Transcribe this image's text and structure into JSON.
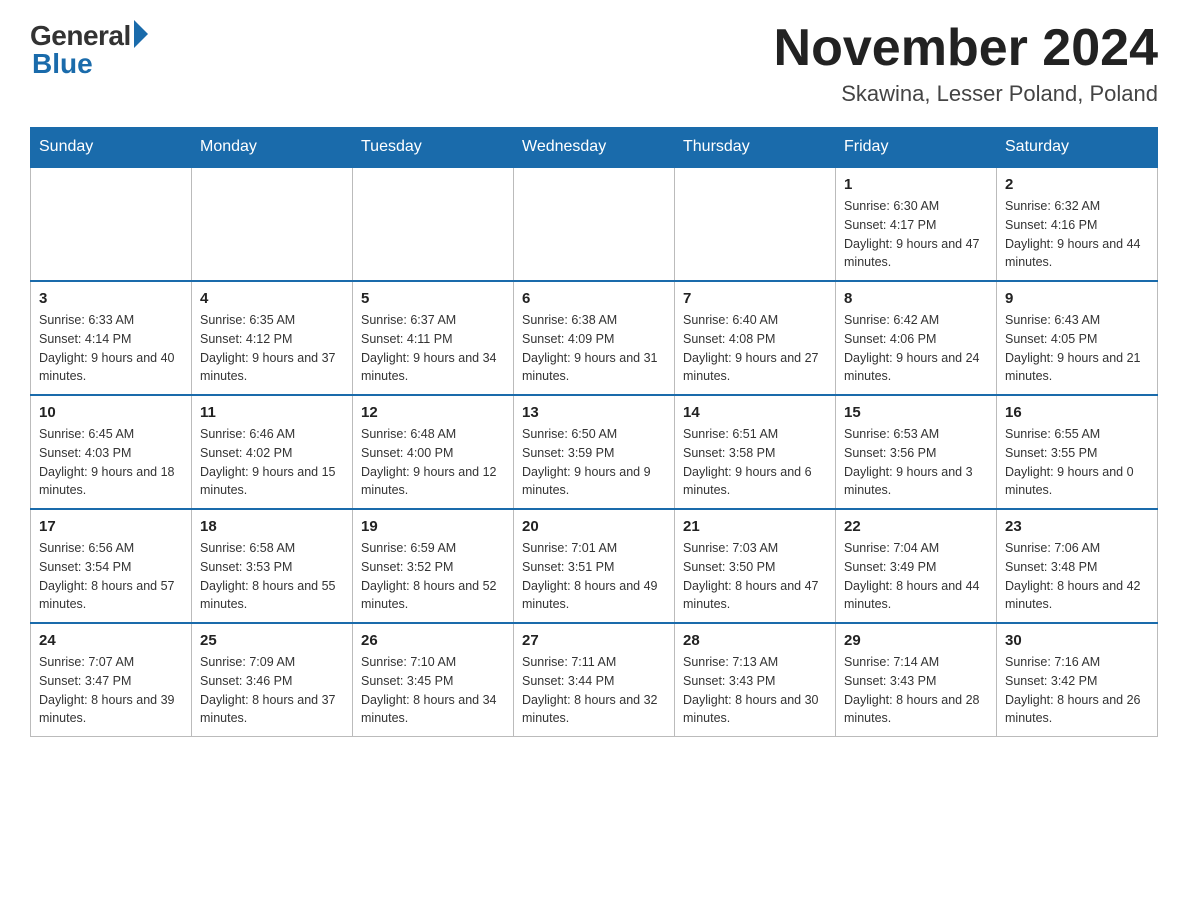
{
  "header": {
    "logo_general": "General",
    "logo_blue": "Blue",
    "month_title": "November 2024",
    "location": "Skawina, Lesser Poland, Poland"
  },
  "days_of_week": [
    "Sunday",
    "Monday",
    "Tuesday",
    "Wednesday",
    "Thursday",
    "Friday",
    "Saturday"
  ],
  "weeks": [
    [
      {
        "day": "",
        "info": ""
      },
      {
        "day": "",
        "info": ""
      },
      {
        "day": "",
        "info": ""
      },
      {
        "day": "",
        "info": ""
      },
      {
        "day": "",
        "info": ""
      },
      {
        "day": "1",
        "info": "Sunrise: 6:30 AM\nSunset: 4:17 PM\nDaylight: 9 hours and 47 minutes."
      },
      {
        "day": "2",
        "info": "Sunrise: 6:32 AM\nSunset: 4:16 PM\nDaylight: 9 hours and 44 minutes."
      }
    ],
    [
      {
        "day": "3",
        "info": "Sunrise: 6:33 AM\nSunset: 4:14 PM\nDaylight: 9 hours and 40 minutes."
      },
      {
        "day": "4",
        "info": "Sunrise: 6:35 AM\nSunset: 4:12 PM\nDaylight: 9 hours and 37 minutes."
      },
      {
        "day": "5",
        "info": "Sunrise: 6:37 AM\nSunset: 4:11 PM\nDaylight: 9 hours and 34 minutes."
      },
      {
        "day": "6",
        "info": "Sunrise: 6:38 AM\nSunset: 4:09 PM\nDaylight: 9 hours and 31 minutes."
      },
      {
        "day": "7",
        "info": "Sunrise: 6:40 AM\nSunset: 4:08 PM\nDaylight: 9 hours and 27 minutes."
      },
      {
        "day": "8",
        "info": "Sunrise: 6:42 AM\nSunset: 4:06 PM\nDaylight: 9 hours and 24 minutes."
      },
      {
        "day": "9",
        "info": "Sunrise: 6:43 AM\nSunset: 4:05 PM\nDaylight: 9 hours and 21 minutes."
      }
    ],
    [
      {
        "day": "10",
        "info": "Sunrise: 6:45 AM\nSunset: 4:03 PM\nDaylight: 9 hours and 18 minutes."
      },
      {
        "day": "11",
        "info": "Sunrise: 6:46 AM\nSunset: 4:02 PM\nDaylight: 9 hours and 15 minutes."
      },
      {
        "day": "12",
        "info": "Sunrise: 6:48 AM\nSunset: 4:00 PM\nDaylight: 9 hours and 12 minutes."
      },
      {
        "day": "13",
        "info": "Sunrise: 6:50 AM\nSunset: 3:59 PM\nDaylight: 9 hours and 9 minutes."
      },
      {
        "day": "14",
        "info": "Sunrise: 6:51 AM\nSunset: 3:58 PM\nDaylight: 9 hours and 6 minutes."
      },
      {
        "day": "15",
        "info": "Sunrise: 6:53 AM\nSunset: 3:56 PM\nDaylight: 9 hours and 3 minutes."
      },
      {
        "day": "16",
        "info": "Sunrise: 6:55 AM\nSunset: 3:55 PM\nDaylight: 9 hours and 0 minutes."
      }
    ],
    [
      {
        "day": "17",
        "info": "Sunrise: 6:56 AM\nSunset: 3:54 PM\nDaylight: 8 hours and 57 minutes."
      },
      {
        "day": "18",
        "info": "Sunrise: 6:58 AM\nSunset: 3:53 PM\nDaylight: 8 hours and 55 minutes."
      },
      {
        "day": "19",
        "info": "Sunrise: 6:59 AM\nSunset: 3:52 PM\nDaylight: 8 hours and 52 minutes."
      },
      {
        "day": "20",
        "info": "Sunrise: 7:01 AM\nSunset: 3:51 PM\nDaylight: 8 hours and 49 minutes."
      },
      {
        "day": "21",
        "info": "Sunrise: 7:03 AM\nSunset: 3:50 PM\nDaylight: 8 hours and 47 minutes."
      },
      {
        "day": "22",
        "info": "Sunrise: 7:04 AM\nSunset: 3:49 PM\nDaylight: 8 hours and 44 minutes."
      },
      {
        "day": "23",
        "info": "Sunrise: 7:06 AM\nSunset: 3:48 PM\nDaylight: 8 hours and 42 minutes."
      }
    ],
    [
      {
        "day": "24",
        "info": "Sunrise: 7:07 AM\nSunset: 3:47 PM\nDaylight: 8 hours and 39 minutes."
      },
      {
        "day": "25",
        "info": "Sunrise: 7:09 AM\nSunset: 3:46 PM\nDaylight: 8 hours and 37 minutes."
      },
      {
        "day": "26",
        "info": "Sunrise: 7:10 AM\nSunset: 3:45 PM\nDaylight: 8 hours and 34 minutes."
      },
      {
        "day": "27",
        "info": "Sunrise: 7:11 AM\nSunset: 3:44 PM\nDaylight: 8 hours and 32 minutes."
      },
      {
        "day": "28",
        "info": "Sunrise: 7:13 AM\nSunset: 3:43 PM\nDaylight: 8 hours and 30 minutes."
      },
      {
        "day": "29",
        "info": "Sunrise: 7:14 AM\nSunset: 3:43 PM\nDaylight: 8 hours and 28 minutes."
      },
      {
        "day": "30",
        "info": "Sunrise: 7:16 AM\nSunset: 3:42 PM\nDaylight: 8 hours and 26 minutes."
      }
    ]
  ]
}
